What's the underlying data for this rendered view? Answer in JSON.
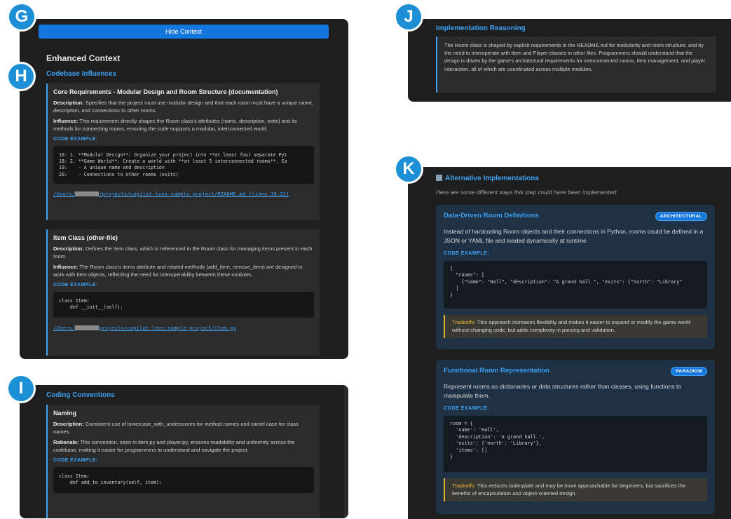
{
  "badges": {
    "g": "G",
    "h": "H",
    "i": "I",
    "j": "J",
    "k": "K"
  },
  "context_panel": {
    "hide_button": "Hide Context",
    "heading": "Enhanced Context",
    "subheading": "Codebase Influences",
    "cards": [
      {
        "title": "Core Requirements - Modular Design and Room Structure (documentation)",
        "description_label": "Description:",
        "description": "Specifies that the project must use modular design and that each room must have a unique name, description, and connections to other rooms.",
        "influence_label": "Influence:",
        "influence": "This requirement directly shapes the Room class's attributes (name, description, exits) and its methods for connecting rooms, ensuring the code supports a modular, interconnected world.",
        "code_label": "CODE EXAMPLE:",
        "code": "16: 1. **Modular Design**: Organize your project into **at least four separate Pyt\n18: 2. **Game World**: Create a world with **at least 5 interconnected rooms**. Ea\n19:    - A unique name and description\n20:    - Connections to other rooms (exits)",
        "link_prefix": "/Users/",
        "link_suffix": "/projects/copilot-lens-sample-project/README.md (lines 16-21)"
      },
      {
        "title": "Item Class (other-file)",
        "description_label": "Description:",
        "description": "Defines the Item class, which is referenced in the Room class for managing items present in each room.",
        "influence_label": "Influence:",
        "influence": "The Room class's items attribute and related methods (add_item, remove_item) are designed to work with Item objects, reflecting the need for interoperability between these modules.",
        "code_label": "CODE EXAMPLE:",
        "code": "class Item:\n    def __init__(self):",
        "link_prefix": "/Users/",
        "link_suffix": "projects/copilot-lens-sample-project/item.py"
      }
    ]
  },
  "conventions_panel": {
    "heading": "Coding Conventions",
    "card": {
      "title": "Naming",
      "description_label": "Description:",
      "description": "Consistent use of lowercase_with_underscores for method names and camel case for class names.",
      "rationale_label": "Rationale:",
      "rationale": "This convention, seen in item.py and player.py, ensures readability and uniformity across the codebase, making it easier for programmers to understand and navigate the project.",
      "code_label": "CODE EXAMPLE:",
      "code": "class Item:\n    def add_to_inventory(self, item):"
    }
  },
  "reasoning_panel": {
    "heading": "Implementation Reasoning",
    "text": "The Room class is shaped by explicit requirements in the README.md for modularity and room structure, and by the need to interoperate with Item and Player classes in other files. Programmers should understand that the design is driven by the game's architectural requirements for interconnected rooms, item management, and player interaction, all of which are coordinated across multiple modules."
  },
  "alternatives_panel": {
    "heading": "Alternative Implementations",
    "intro": "Here are some different ways this step could have been implemented:",
    "items": [
      {
        "name": "Data-Driven Room Definitions",
        "tag": "ARCHITECTURAL",
        "description": "Instead of hardcoding Room objects and their connections in Python, rooms could be defined in a JSON or YAML file and loaded dynamically at runtime.",
        "code_label": "CODE EXAMPLE:",
        "code": "{\n  \"rooms\": [\n    {\"name\": \"Hall\", \"description\": \"A grand hall.\", \"exits\": {\"north\": \"Library\"\n  ]\n}",
        "tradeoffs_label": "Tradeoffs:",
        "tradeoffs": "This approach increases flexibility and makes it easier to expand or modify the game world without changing code, but adds complexity in parsing and validation."
      },
      {
        "name": "Functional Room Representation",
        "tag": "PARADIGM",
        "description": "Represent rooms as dictionaries or data structures rather than classes, using functions to manipulate them.",
        "code_label": "CODE EXAMPLE:",
        "code": "room = {\n  'name': 'Hall',\n  'description': 'A grand hall.',\n  'exits': {'north': 'Library'},\n  'items': []\n}",
        "tradeoffs_label": "Tradeoffs:",
        "tradeoffs": "This reduces boilerplate and may be more approachable for beginners, but sacrifices the benefits of encapsulation and object-oriented design."
      }
    ]
  },
  "colors": {
    "accent": "#3ea2f5",
    "button": "#1577dd",
    "badge": "#1c8fd6",
    "tradeoff": "#e0b12c"
  }
}
